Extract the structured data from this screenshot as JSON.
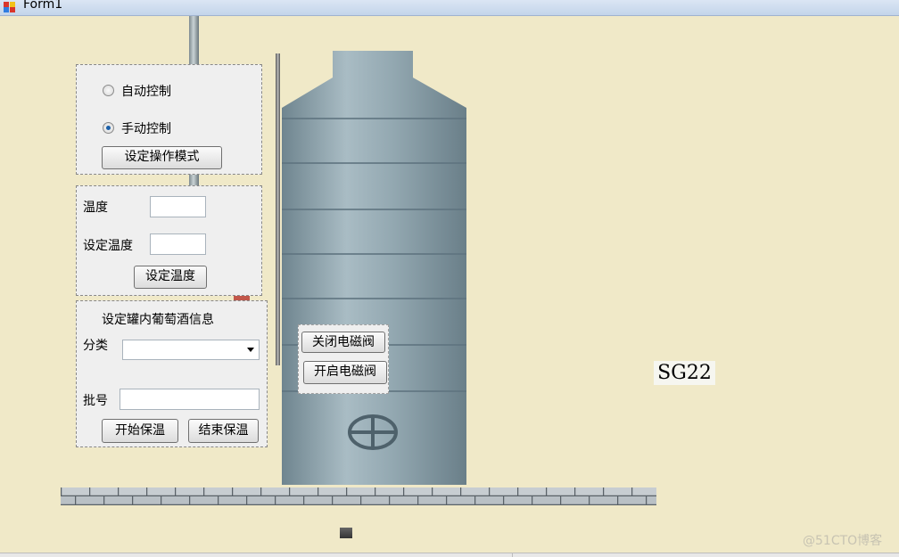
{
  "window": {
    "title": "Form1"
  },
  "mode_panel": {
    "auto_label": "自动控制",
    "manual_label": "手动控制",
    "selected": "manual",
    "set_mode_button": "设定操作模式"
  },
  "temp_panel": {
    "temp_label": "温度",
    "temp_value": "",
    "set_temp_label": "设定温度",
    "set_temp_value": "",
    "set_temp_button": "设定温度"
  },
  "wine_panel": {
    "heading": "设定罐内葡萄酒信息",
    "category_label": "分类",
    "category_value": "",
    "batch_label": "批号",
    "batch_value": "",
    "start_button": "开始保温",
    "stop_button": "结束保温"
  },
  "valve_panel": {
    "close_button": "关闭电磁阀",
    "open_button": "开启电磁阀"
  },
  "tank_label": "SG22",
  "watermark": "@51CTO博客",
  "colors": {
    "background": "#f0e9c8",
    "tank": "#8fa3ad",
    "radio_selected": "#1b5fa8"
  }
}
